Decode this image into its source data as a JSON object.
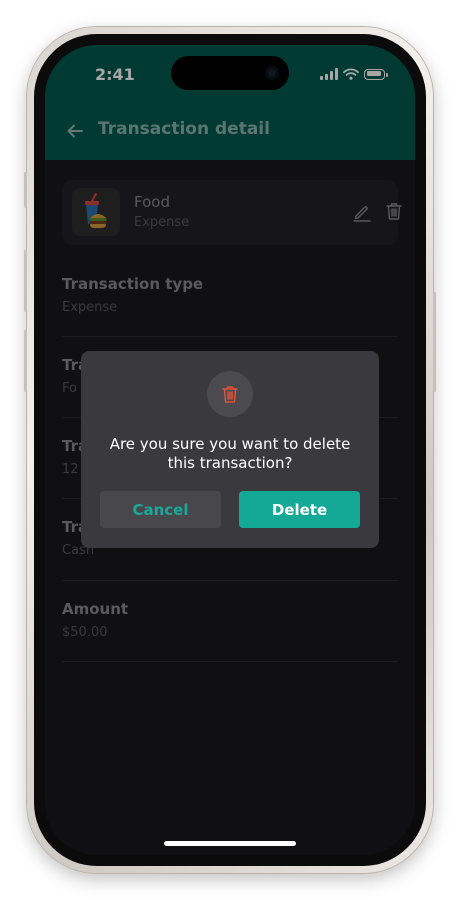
{
  "status_bar": {
    "time": "2:41"
  },
  "header": {
    "title": "Transaction detail",
    "back_icon": "arrow-left-icon"
  },
  "category": {
    "name": "Food",
    "type": "Expense",
    "icon": "food-drink-icon"
  },
  "fields": [
    {
      "label": "Transaction type",
      "value": "Expense"
    },
    {
      "label": "Tra",
      "value": "Fo"
    },
    {
      "label": "Tra",
      "value": "12 ,"
    },
    {
      "label": "Tra",
      "value": "Cash"
    },
    {
      "label": "Amount",
      "value": "$50.00"
    }
  ],
  "dialog": {
    "icon": "trash-icon",
    "message": "Are you sure you want to delete this transaction?",
    "cancel_label": "Cancel",
    "delete_label": "Delete"
  },
  "colors": {
    "header_bg": "#035a4e",
    "accent": "#14a896",
    "danger": "#e0533a",
    "screen_bg": "#1a1a1c",
    "dialog_bg": "#3a3a3e"
  }
}
